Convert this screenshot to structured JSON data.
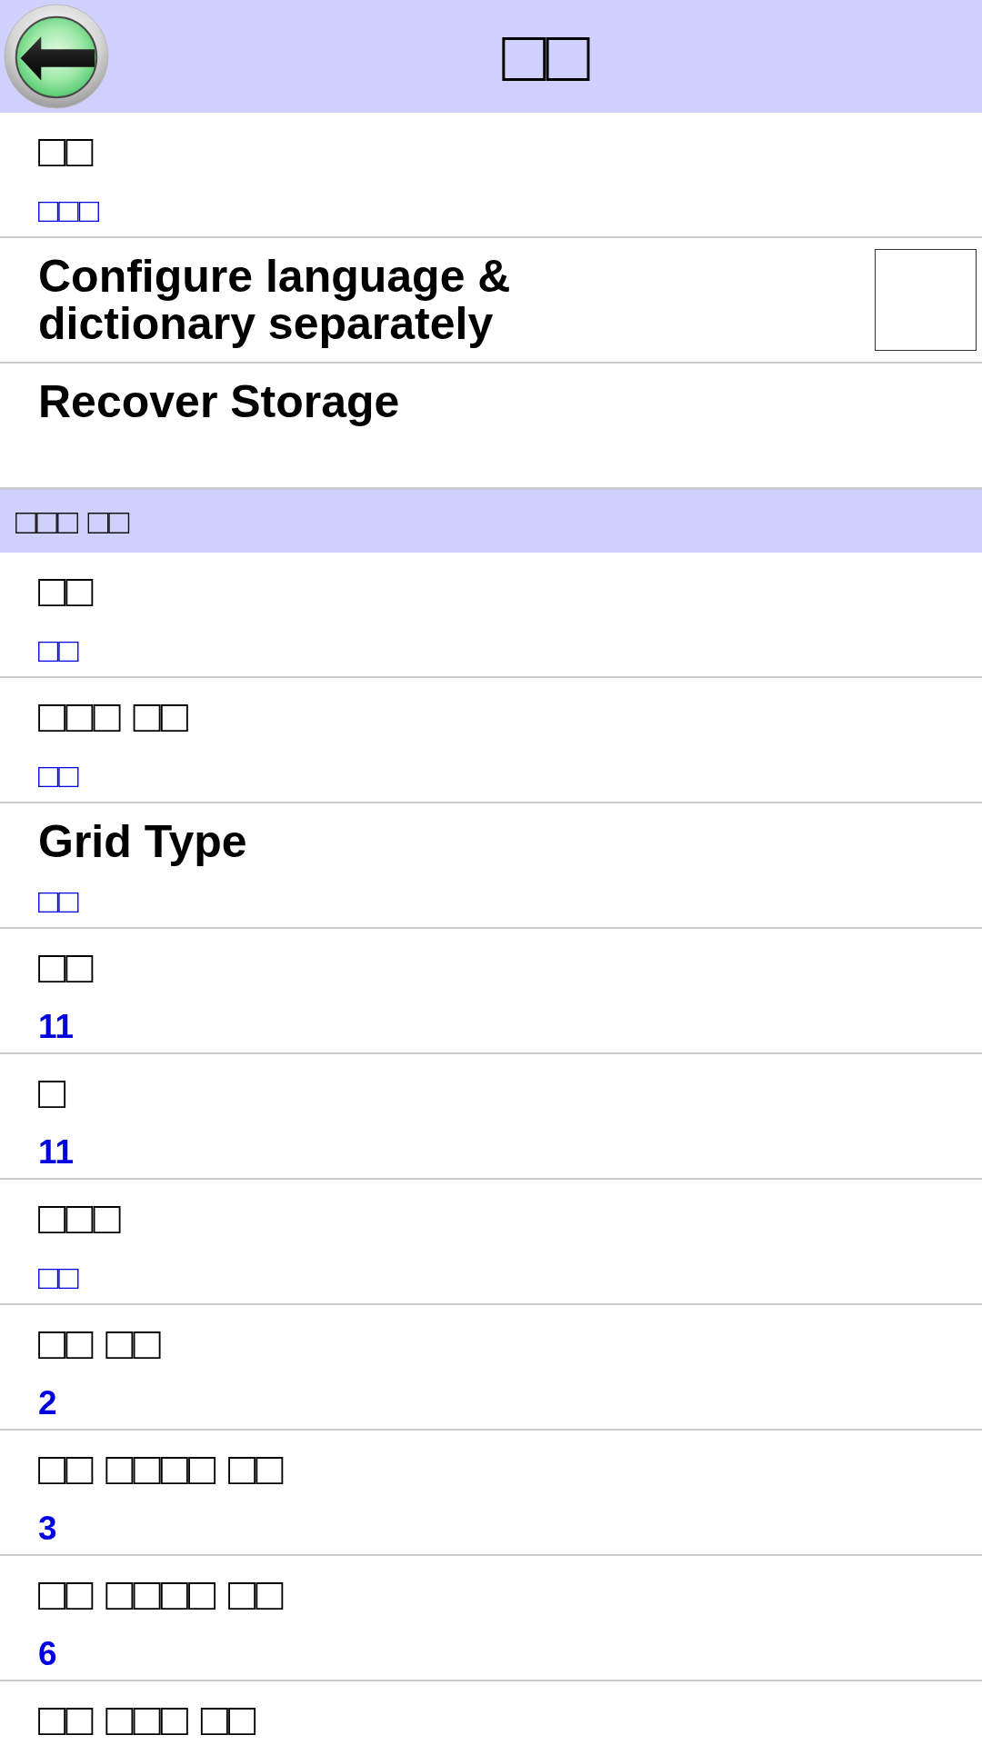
{
  "header": {
    "title": "□□"
  },
  "sections": [
    {
      "items": [
        {
          "kind": "text",
          "title": "□□",
          "summary": "□□□"
        },
        {
          "kind": "checkbox",
          "title": "Configure language & dictionary separately",
          "checked": false
        },
        {
          "kind": "text",
          "title": "Recover Storage"
        }
      ]
    },
    {
      "title": "□□□ □□",
      "items": [
        {
          "kind": "text",
          "title": "□□",
          "summary": "□□"
        },
        {
          "kind": "text",
          "title": "□□□ □□",
          "summary": "□□"
        },
        {
          "kind": "text",
          "title": "Grid Type",
          "summary": "□□"
        },
        {
          "kind": "text",
          "title": "□□",
          "summary": "11"
        },
        {
          "kind": "text",
          "title": "□",
          "summary": "11"
        },
        {
          "kind": "text",
          "title": "□□□",
          "summary": "□□"
        },
        {
          "kind": "text",
          "title": "□□ □□",
          "summary": "2"
        },
        {
          "kind": "text",
          "title": "□□ □□□□ □□",
          "summary": "3"
        },
        {
          "kind": "text",
          "title": "□□ □□□□ □□",
          "summary": "6"
        },
        {
          "kind": "text",
          "title": "□□ □□□ □□"
        }
      ]
    }
  ]
}
